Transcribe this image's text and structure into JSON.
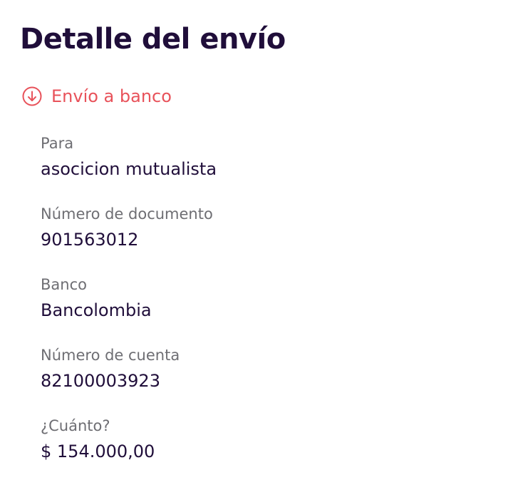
{
  "header": {
    "title": "Detalle del envío"
  },
  "section": {
    "icon": "arrow-down-circle-icon",
    "label": "Envío a banco",
    "color": "#e8525a"
  },
  "fields": [
    {
      "label": "Para",
      "value": "asocicion mutualista"
    },
    {
      "label": "Número de documento",
      "value": "901563012"
    },
    {
      "label": "Banco",
      "value": "Bancolombia"
    },
    {
      "label": "Número de cuenta",
      "value": "82100003923"
    },
    {
      "label": "¿Cuánto?",
      "value": "$ 154.000,00"
    }
  ],
  "colors": {
    "title": "#200e3a",
    "label": "#6e6e73",
    "value": "#200e3a",
    "accent": "#e8525a"
  }
}
